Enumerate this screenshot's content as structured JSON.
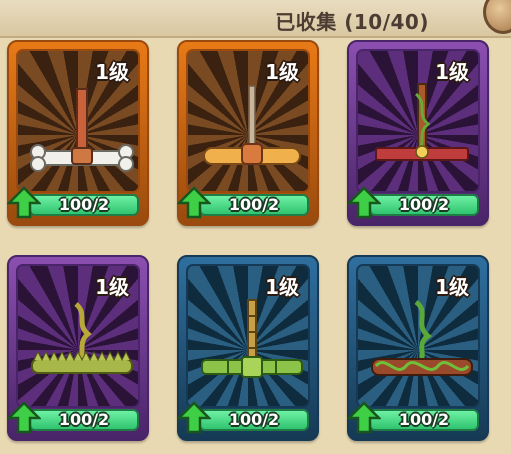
{
  "header": {
    "collected": "已收集 (10/40)"
  },
  "colors": {
    "orange": "#e87a16",
    "purple": "#8b4fb0",
    "blue": "#2f6f9f",
    "progress_green": "#2fc46f"
  },
  "cards": [
    {
      "level": "1级",
      "progress": "100/2",
      "rarity": "orange",
      "item_icon": "bone-bow-icon"
    },
    {
      "level": "1级",
      "progress": "100/2",
      "rarity": "orange",
      "item_icon": "bread-bow-icon"
    },
    {
      "level": "1级",
      "progress": "100/2",
      "rarity": "purple",
      "item_icon": "vine-wood-bow-icon"
    },
    {
      "level": "1级",
      "progress": "100/2",
      "rarity": "purple",
      "item_icon": "thorn-bow-icon"
    },
    {
      "level": "1级",
      "progress": "100/2",
      "rarity": "blue",
      "item_icon": "bamboo-bow-icon"
    },
    {
      "level": "1级",
      "progress": "100/2",
      "rarity": "blue",
      "item_icon": "vine-log-bow-icon"
    }
  ]
}
